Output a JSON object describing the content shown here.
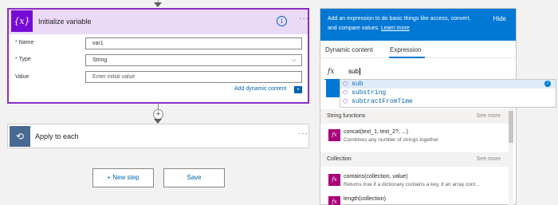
{
  "init_card": {
    "icon_text": "{x}",
    "title": "Initialize variable",
    "info_glyph": "i",
    "more_glyph": "···",
    "fields": {
      "name_label": "Name",
      "name_value": "var1",
      "type_label": "Type",
      "type_value": "String",
      "value_label": "Value",
      "value_placeholder": "Enter initial value",
      "required_mark": "*"
    },
    "add_dynamic": "Add dynamic content"
  },
  "apply_card": {
    "title": "Apply to each",
    "more_glyph": "···"
  },
  "connector": {
    "plus_glyph": "+"
  },
  "buttons": {
    "new_step": "+ New step",
    "save": "Save"
  },
  "panel": {
    "banner_text": "Add an expression to do basic things like access, convert, and compare values.",
    "learn_more": "Learn more",
    "hide": "Hide",
    "tabs": [
      "Dynamic content",
      "Expression"
    ],
    "active_tab": "Expression",
    "fx": "fx",
    "expression_value": "sub",
    "suggestions": [
      "sub",
      "substring",
      "subtractFromTime"
    ],
    "sections": [
      {
        "title": "String functions",
        "see_more": "See more",
        "items": [
          {
            "name": "concat(text_1, text_2?, ...)",
            "desc": "Combines any number of strings together"
          }
        ]
      },
      {
        "title": "Collection",
        "see_more": "See more",
        "items": [
          {
            "name": "contains(collection, value)",
            "desc": "Returns true if a dictionary contains a key, if an array cont..."
          },
          {
            "name": "length(collection)",
            "desc": ""
          }
        ]
      }
    ]
  },
  "colors": {
    "accent": "#0078d4",
    "variable_purple": "#770bd6",
    "card_header": "#ead9f7",
    "apply_blue": "#486991",
    "function_icon": "#a80078"
  }
}
